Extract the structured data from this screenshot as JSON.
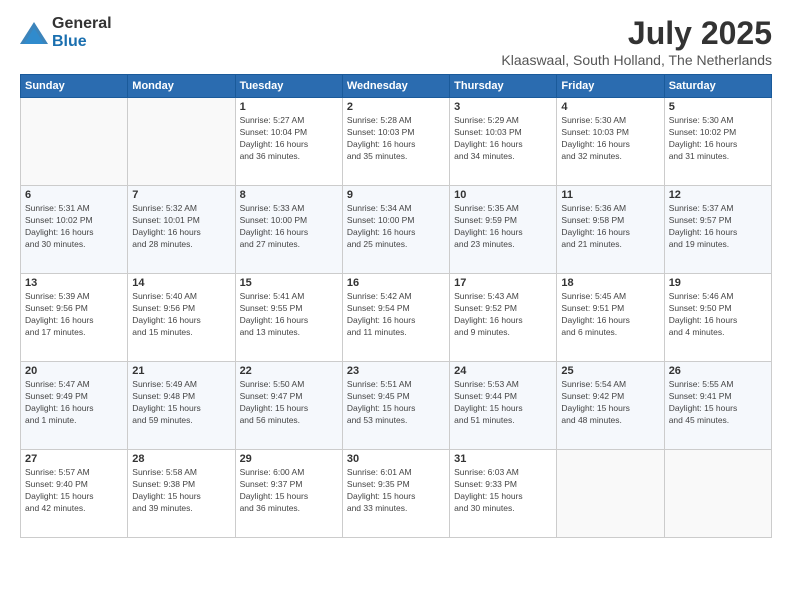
{
  "header": {
    "logo_general": "General",
    "logo_blue": "Blue",
    "month_title": "July 2025",
    "subtitle": "Klaaswaal, South Holland, The Netherlands"
  },
  "days_of_week": [
    "Sunday",
    "Monday",
    "Tuesday",
    "Wednesday",
    "Thursday",
    "Friday",
    "Saturday"
  ],
  "weeks": [
    [
      {
        "day": "",
        "detail": ""
      },
      {
        "day": "",
        "detail": ""
      },
      {
        "day": "1",
        "detail": "Sunrise: 5:27 AM\nSunset: 10:04 PM\nDaylight: 16 hours\nand 36 minutes."
      },
      {
        "day": "2",
        "detail": "Sunrise: 5:28 AM\nSunset: 10:03 PM\nDaylight: 16 hours\nand 35 minutes."
      },
      {
        "day": "3",
        "detail": "Sunrise: 5:29 AM\nSunset: 10:03 PM\nDaylight: 16 hours\nand 34 minutes."
      },
      {
        "day": "4",
        "detail": "Sunrise: 5:30 AM\nSunset: 10:03 PM\nDaylight: 16 hours\nand 32 minutes."
      },
      {
        "day": "5",
        "detail": "Sunrise: 5:30 AM\nSunset: 10:02 PM\nDaylight: 16 hours\nand 31 minutes."
      }
    ],
    [
      {
        "day": "6",
        "detail": "Sunrise: 5:31 AM\nSunset: 10:02 PM\nDaylight: 16 hours\nand 30 minutes."
      },
      {
        "day": "7",
        "detail": "Sunrise: 5:32 AM\nSunset: 10:01 PM\nDaylight: 16 hours\nand 28 minutes."
      },
      {
        "day": "8",
        "detail": "Sunrise: 5:33 AM\nSunset: 10:00 PM\nDaylight: 16 hours\nand 27 minutes."
      },
      {
        "day": "9",
        "detail": "Sunrise: 5:34 AM\nSunset: 10:00 PM\nDaylight: 16 hours\nand 25 minutes."
      },
      {
        "day": "10",
        "detail": "Sunrise: 5:35 AM\nSunset: 9:59 PM\nDaylight: 16 hours\nand 23 minutes."
      },
      {
        "day": "11",
        "detail": "Sunrise: 5:36 AM\nSunset: 9:58 PM\nDaylight: 16 hours\nand 21 minutes."
      },
      {
        "day": "12",
        "detail": "Sunrise: 5:37 AM\nSunset: 9:57 PM\nDaylight: 16 hours\nand 19 minutes."
      }
    ],
    [
      {
        "day": "13",
        "detail": "Sunrise: 5:39 AM\nSunset: 9:56 PM\nDaylight: 16 hours\nand 17 minutes."
      },
      {
        "day": "14",
        "detail": "Sunrise: 5:40 AM\nSunset: 9:56 PM\nDaylight: 16 hours\nand 15 minutes."
      },
      {
        "day": "15",
        "detail": "Sunrise: 5:41 AM\nSunset: 9:55 PM\nDaylight: 16 hours\nand 13 minutes."
      },
      {
        "day": "16",
        "detail": "Sunrise: 5:42 AM\nSunset: 9:54 PM\nDaylight: 16 hours\nand 11 minutes."
      },
      {
        "day": "17",
        "detail": "Sunrise: 5:43 AM\nSunset: 9:52 PM\nDaylight: 16 hours\nand 9 minutes."
      },
      {
        "day": "18",
        "detail": "Sunrise: 5:45 AM\nSunset: 9:51 PM\nDaylight: 16 hours\nand 6 minutes."
      },
      {
        "day": "19",
        "detail": "Sunrise: 5:46 AM\nSunset: 9:50 PM\nDaylight: 16 hours\nand 4 minutes."
      }
    ],
    [
      {
        "day": "20",
        "detail": "Sunrise: 5:47 AM\nSunset: 9:49 PM\nDaylight: 16 hours\nand 1 minute."
      },
      {
        "day": "21",
        "detail": "Sunrise: 5:49 AM\nSunset: 9:48 PM\nDaylight: 15 hours\nand 59 minutes."
      },
      {
        "day": "22",
        "detail": "Sunrise: 5:50 AM\nSunset: 9:47 PM\nDaylight: 15 hours\nand 56 minutes."
      },
      {
        "day": "23",
        "detail": "Sunrise: 5:51 AM\nSunset: 9:45 PM\nDaylight: 15 hours\nand 53 minutes."
      },
      {
        "day": "24",
        "detail": "Sunrise: 5:53 AM\nSunset: 9:44 PM\nDaylight: 15 hours\nand 51 minutes."
      },
      {
        "day": "25",
        "detail": "Sunrise: 5:54 AM\nSunset: 9:42 PM\nDaylight: 15 hours\nand 48 minutes."
      },
      {
        "day": "26",
        "detail": "Sunrise: 5:55 AM\nSunset: 9:41 PM\nDaylight: 15 hours\nand 45 minutes."
      }
    ],
    [
      {
        "day": "27",
        "detail": "Sunrise: 5:57 AM\nSunset: 9:40 PM\nDaylight: 15 hours\nand 42 minutes."
      },
      {
        "day": "28",
        "detail": "Sunrise: 5:58 AM\nSunset: 9:38 PM\nDaylight: 15 hours\nand 39 minutes."
      },
      {
        "day": "29",
        "detail": "Sunrise: 6:00 AM\nSunset: 9:37 PM\nDaylight: 15 hours\nand 36 minutes."
      },
      {
        "day": "30",
        "detail": "Sunrise: 6:01 AM\nSunset: 9:35 PM\nDaylight: 15 hours\nand 33 minutes."
      },
      {
        "day": "31",
        "detail": "Sunrise: 6:03 AM\nSunset: 9:33 PM\nDaylight: 15 hours\nand 30 minutes."
      },
      {
        "day": "",
        "detail": ""
      },
      {
        "day": "",
        "detail": ""
      }
    ]
  ]
}
